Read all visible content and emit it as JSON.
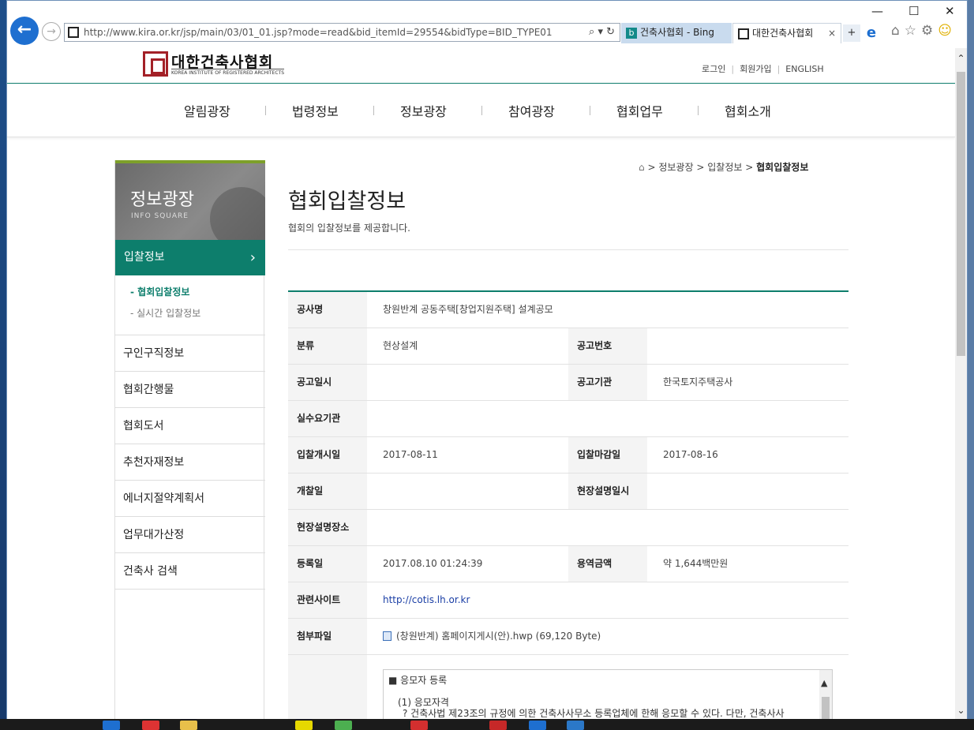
{
  "browser": {
    "url": "http://www.kira.or.kr/jsp/main/03/01_01.jsp?mode=read&bid_itemId=29554&bidType=BID_TYPE01",
    "addr_tools": "⌕ ▾ ↻",
    "tabs": [
      {
        "label": "건축사협회 - Bing",
        "icon": "b"
      },
      {
        "label": "대한건축사협회",
        "close": "×"
      }
    ],
    "window_controls": {
      "minimize": "—",
      "maximize": "☐",
      "close": "✕"
    }
  },
  "site": {
    "logo": {
      "name": "대한건축사협회",
      "english": "KOREA INSTITUTE OF REGISTERED ARCHITECTS"
    },
    "util": {
      "login": "로그인",
      "join": "회원가입",
      "english": "ENGLISH"
    },
    "gnb": [
      "알림광장",
      "법령정보",
      "정보광장",
      "참여광장",
      "협회업무",
      "협회소개"
    ],
    "lnb": {
      "hero_title": "정보광장",
      "hero_sub": "INFO SQUARE",
      "active": "입찰정보",
      "active_chevron": "›",
      "sub": [
        "- 협회입찰정보",
        "- 실시간 입찰정보"
      ],
      "items": [
        "구인구직정보",
        "협회간행물",
        "협회도서",
        "추천자재정보",
        "에너지절약계획서",
        "업무대가산정",
        "건축사 검색"
      ]
    },
    "breadcrumb": {
      "home_icon": "⌂",
      "sep": ">",
      "level1": "정보광장",
      "level2": "입찰정보",
      "current": "협회입찰정보"
    },
    "page": {
      "title": "협회입찰정보",
      "desc": "협회의 입찰정보를 제공합니다."
    },
    "detail": {
      "project_label": "공사명",
      "project_value": "창원반계 공동주택[창업지원주택] 설계공모",
      "category_label": "분류",
      "category_value": "현상설계",
      "notice_no_label": "공고번호",
      "notice_no_value": "",
      "notice_date_label": "공고일시",
      "notice_date_value": "",
      "agency_label": "공고기관",
      "agency_value": "한국토지주택공사",
      "demand_label": "실수요기관",
      "demand_value": "",
      "bid_start_label": "입찰개시일",
      "bid_start_value": "2017-08-11",
      "bid_end_label": "입찰마감일",
      "bid_end_value": "2017-08-16",
      "open_label": "개찰일",
      "open_value": "",
      "briefing_date_label": "현장설명일시",
      "briefing_date_value": "",
      "briefing_place_label": "현장설명장소",
      "briefing_place_value": "",
      "reg_label": "등록일",
      "reg_value": "2017.08.10 01:24:39",
      "amount_label": "용역금액",
      "amount_value": "약 1,644백만원",
      "site_label": "관련사이트",
      "site_value": "http://cotis.lh.or.kr",
      "file_label": "첨부파일",
      "file_value": "(창원반계) 홈페이지게시(안).hwp (69,120 Byte)",
      "memo_line1": "■ 응모자 등록",
      "memo_line2": "(1) 응모자격",
      "memo_line3": "? 건축사법 제23조의 규정에 의한 건축사사무소 등록업체에 한해 응모할 수 있다. 다만, 건축사사"
    }
  }
}
